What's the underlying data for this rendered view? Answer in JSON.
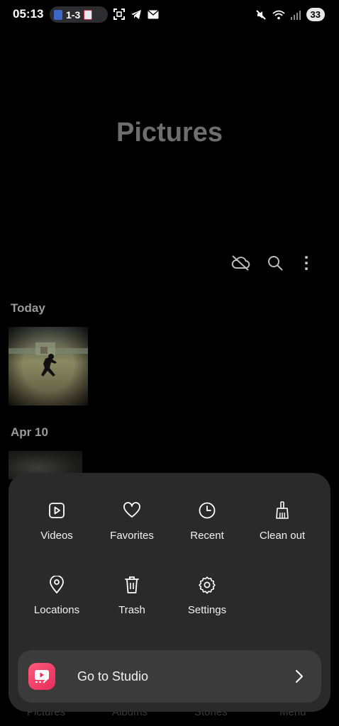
{
  "status_bar": {
    "time": "05:13",
    "score": "1-3",
    "battery": "33"
  },
  "header": {
    "title": "Pictures"
  },
  "toolbar": {
    "icons": [
      "cloud-off-icon",
      "search-icon",
      "more-vert-icon"
    ]
  },
  "gallery": {
    "sections": [
      {
        "label": "Today"
      },
      {
        "label": "Apr 10"
      }
    ]
  },
  "menu": {
    "items": [
      {
        "label": "Videos",
        "icon": "video-icon"
      },
      {
        "label": "Favorites",
        "icon": "heart-icon"
      },
      {
        "label": "Recent",
        "icon": "clock-icon"
      },
      {
        "label": "Clean out",
        "icon": "broom-icon"
      },
      {
        "label": "Locations",
        "icon": "location-pin-icon"
      },
      {
        "label": "Trash",
        "icon": "trash-icon"
      },
      {
        "label": "Settings",
        "icon": "gear-icon"
      }
    ],
    "studio_label": "Go to Studio"
  },
  "bottom_nav": {
    "items": [
      "Pictures",
      "Albums",
      "Stories",
      "Menu"
    ]
  },
  "colors": {
    "accent_studio": "#e62e58",
    "sheet_bg": "#2a2a2b"
  }
}
